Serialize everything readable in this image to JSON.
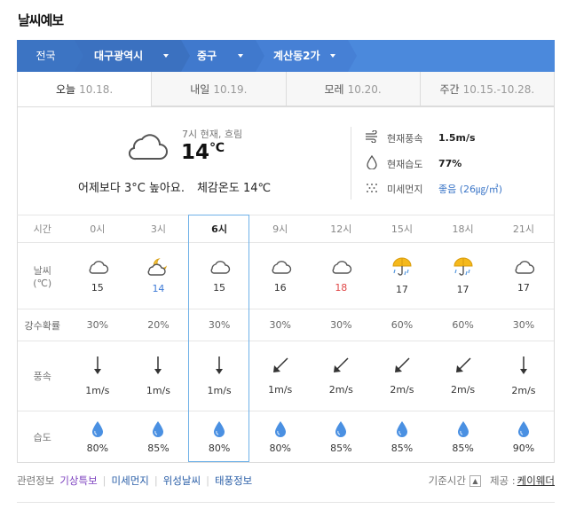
{
  "title": "날씨예보",
  "location": {
    "items": [
      {
        "label": "전국"
      },
      {
        "label": "대구광역시"
      },
      {
        "label": "중구"
      },
      {
        "label": "계산동2가"
      }
    ]
  },
  "tabs": [
    {
      "label": "오늘",
      "date": "10.18.",
      "active": true
    },
    {
      "label": "내일",
      "date": "10.19."
    },
    {
      "label": "모레",
      "date": "10.20."
    },
    {
      "label": "주간",
      "date": "10.15.-10.28."
    }
  ],
  "now": {
    "time_text": "7시 현재, 흐림",
    "temp": "14",
    "unit": "℃",
    "compare": "어제보다 3°C 높아요.",
    "feel": "체감온도 14℃",
    "wind_label": "현재풍속",
    "wind_value": "1.5m/s",
    "humidity_label": "현재습도",
    "humidity_value": "77%",
    "dust_label": "미세먼지",
    "dust_value": "좋음 (26㎍/㎥)",
    "icon": "cloud-icon"
  },
  "forecast": {
    "row_labels": {
      "time": "시간",
      "sky": "날씨",
      "sky_unit": "(℃)",
      "rain": "강수확률",
      "wind": "풍속",
      "humidity": "습도"
    },
    "columns": [
      {
        "time": "0시",
        "icon": "cloud",
        "temp": "15",
        "rain": "30%",
        "wind_dir": "down",
        "wind": "1m/s",
        "hum": "80%"
      },
      {
        "time": "3시",
        "icon": "moon-cloud",
        "temp": "14",
        "temp_color": "cold",
        "rain": "20%",
        "wind_dir": "down",
        "wind": "1m/s",
        "hum": "85%"
      },
      {
        "time": "6시",
        "icon": "cloud",
        "temp": "15",
        "rain": "30%",
        "wind_dir": "down",
        "wind": "1m/s",
        "hum": "80%",
        "current": true
      },
      {
        "time": "9시",
        "icon": "cloud",
        "temp": "16",
        "rain": "30%",
        "wind_dir": "down-left",
        "wind": "1m/s",
        "hum": "80%"
      },
      {
        "time": "12시",
        "icon": "cloud",
        "temp": "18",
        "temp_color": "hot",
        "rain": "30%",
        "wind_dir": "down-left",
        "wind": "2m/s",
        "hum": "85%"
      },
      {
        "time": "15시",
        "icon": "umbrella",
        "temp": "17",
        "rain": "60%",
        "wind_dir": "down-left",
        "wind": "2m/s",
        "hum": "85%"
      },
      {
        "time": "18시",
        "icon": "umbrella",
        "temp": "17",
        "rain": "60%",
        "wind_dir": "down-left",
        "wind": "2m/s",
        "hum": "85%"
      },
      {
        "time": "21시",
        "icon": "cloud",
        "temp": "17",
        "rain": "30%",
        "wind_dir": "down",
        "wind": "2m/s",
        "hum": "90%"
      }
    ]
  },
  "footer": {
    "related_label": "관련정보",
    "links": [
      "기상특보",
      "미세먼지",
      "위성날씨",
      "태풍정보"
    ],
    "basetime_label": "기준시간",
    "provider_label": "제공 :",
    "provider": "케이웨더"
  },
  "colors": {
    "accent": "#4b89dc",
    "current_border": "#6fb1e8",
    "cold": "#3d7ad6",
    "hot": "#e04848"
  }
}
